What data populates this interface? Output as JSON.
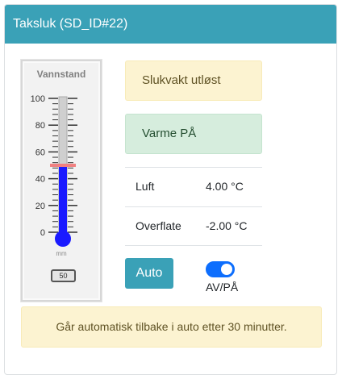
{
  "header": {
    "title": "Taksluk (SD_ID#22)"
  },
  "gauge": {
    "title": "Vannstand",
    "unit": "mm",
    "readout": "50",
    "value": 50,
    "alarm_level": 50,
    "scale_min": 0,
    "scale_max": 100,
    "tick_labels": [
      "100",
      "80",
      "60",
      "40",
      "20",
      "0"
    ],
    "fill_color": "#1a1aff",
    "alarm_color": "#f08080"
  },
  "status": {
    "alarm": "Slukvakt utløst",
    "heat": "Varme PÅ"
  },
  "readings": [
    {
      "label": "Luft",
      "value": "4.00 °C"
    },
    {
      "label": "Overflate",
      "value": "-2.00 °C"
    }
  ],
  "controls": {
    "auto_label": "Auto",
    "toggle_label": "AV/PÅ",
    "toggle_on": true,
    "accent": "#3aa1b7"
  },
  "note": "Går automatisk tilbake i auto etter 30 minutter."
}
